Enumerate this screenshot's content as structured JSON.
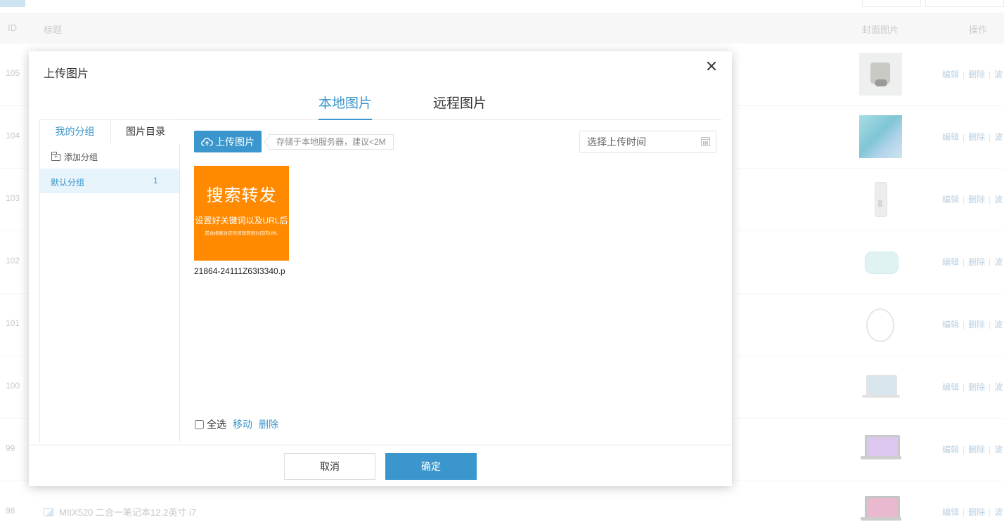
{
  "background": {
    "top_inputs": [
      "",
      ""
    ],
    "columns": {
      "id": "ID",
      "title": "标题",
      "cover": "封面图片",
      "actions": "操作"
    },
    "rows": [
      {
        "id": "105",
        "title": "",
        "thumb": "t-robot"
      },
      {
        "id": "104",
        "title": "",
        "thumb": "t-blue"
      },
      {
        "id": "103",
        "title": "",
        "thumb": "t-speaker"
      },
      {
        "id": "102",
        "title": "",
        "thumb": "t-round"
      },
      {
        "id": "101",
        "title": "",
        "thumb": "t-ear"
      },
      {
        "id": "100",
        "title": "",
        "thumb": "t-laptop"
      },
      {
        "id": "99",
        "title": "",
        "thumb": "t-laptop2"
      },
      {
        "id": "98",
        "title": "MIIX520 二合一笔记本12.2英寸 i7",
        "thumb": "t-laptop3"
      }
    ],
    "ops": {
      "edit": "编辑",
      "delete": "删除",
      "more": "波"
    }
  },
  "modal": {
    "title": "上传图片",
    "tabs": [
      "本地图片",
      "远程图片"
    ],
    "left_tabs": [
      "我的分组",
      "图片目录"
    ],
    "add_group": "添加分组",
    "groups": [
      {
        "label": "默认分组",
        "count": "1"
      }
    ],
    "upload_button": "上传图片",
    "upload_hint": "存储于本地服务器，建议<2M",
    "date_placeholder": "选择上传时间",
    "files": [
      {
        "name": "21864-24111Z63I3340.p",
        "thumb_title": "搜索转发",
        "thumb_sub": "设置好关键词以及URL后",
        "thumb_small": "前台搜索对应的词就转到对应的URL",
        "thumb_color": "#ff8a00"
      }
    ],
    "select_all": "全选",
    "move": "移动",
    "delete": "删除",
    "cancel": "取消",
    "confirm": "确定"
  },
  "colors": {
    "accent": "#3a96cc",
    "thumb_orange": "#ff8a00"
  }
}
